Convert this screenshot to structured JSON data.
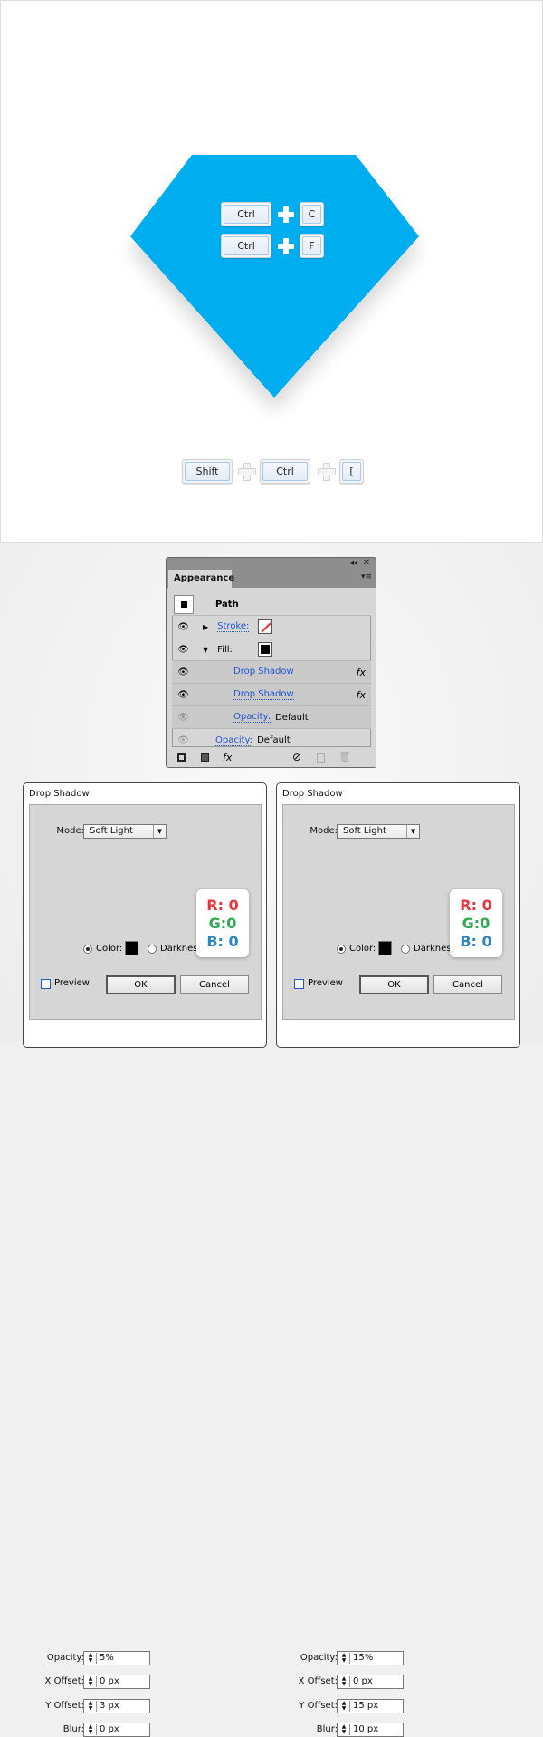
{
  "colors": {
    "shape": "#00adef",
    "link": "#1f55d8",
    "r": "#e8363f",
    "g": "#2fa84f",
    "b": "#2e86c1"
  },
  "canvas": {
    "keys_row1": [
      "Ctrl",
      "C"
    ],
    "keys_row2": [
      "Ctrl",
      "F"
    ],
    "keys_bottom": [
      "Shift",
      "Ctrl",
      "["
    ]
  },
  "panel": {
    "tab": "Appearance",
    "path_label": "Path",
    "stroke_label": "Stroke:",
    "fill_label": "Fill:",
    "effects": [
      "Drop Shadow",
      "Drop Shadow"
    ],
    "fx": "fx",
    "fill_opacity_label": "Opacity:",
    "fill_opacity_value": "Default",
    "opacity_label": "Opacity:",
    "opacity_value": "Default"
  },
  "dialogs": [
    {
      "title": "Drop Shadow",
      "mode_label": "Mode:",
      "mode": "Soft Light",
      "opacity_label": "Opacity:",
      "opacity": "5%",
      "x_label": "X Offset:",
      "x": "0 px",
      "y_label": "Y Offset:",
      "y": "3 px",
      "blur_label": "Blur:",
      "blur": "0 px",
      "color_label": "Color:",
      "darkness_label": "Darknes",
      "preview_label": "Preview",
      "ok": "OK",
      "cancel": "Cancel",
      "r": "R: 0",
      "g": "G:0",
      "b": "B: 0"
    },
    {
      "title": "Drop Shadow",
      "mode_label": "Mode:",
      "mode": "Soft Light",
      "opacity_label": "Opacity:",
      "opacity": "15%",
      "x_label": "X Offset:",
      "x": "0 px",
      "y_label": "Y Offset:",
      "y": "15 px",
      "blur_label": "Blur:",
      "blur": "10 px",
      "color_label": "Color:",
      "darkness_label": "Darknes",
      "preview_label": "Preview",
      "ok": "OK",
      "cancel": "Cancel",
      "r": "R: 0",
      "g": "G:0",
      "b": "B: 0"
    }
  ]
}
